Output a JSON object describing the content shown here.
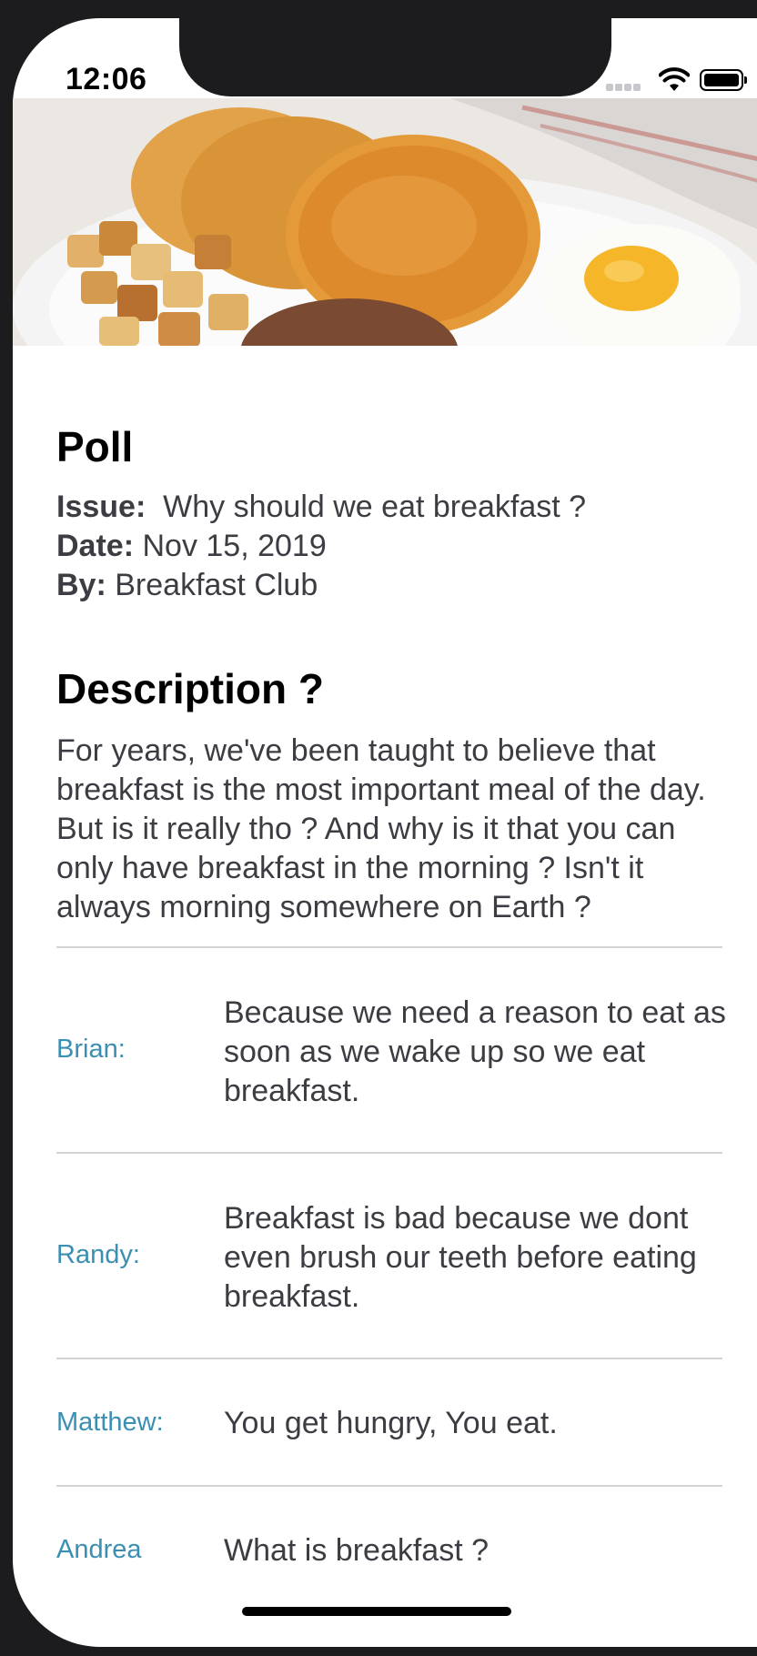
{
  "status_bar": {
    "time": "12:06"
  },
  "poll": {
    "title": "Poll",
    "issue_label": "Issue:",
    "issue": "Why should we eat breakfast ?",
    "date_label": "Date:",
    "date": "Nov 15, 2019",
    "by_label": "By:",
    "by": "Breakfast Club"
  },
  "description": {
    "title": "Description ?",
    "text": "For years, we've been taught to believe that breakfast is the most important meal of the day. But is it really tho ? And why is it that you can only have breakfast in the morning ? Isn't it always morning somewhere on Earth ?"
  },
  "answers": [
    {
      "name": "Brian:",
      "text": "Because we need a reason to eat as soon as we wake up so we eat breakfast."
    },
    {
      "name": "Randy:",
      "text": "Breakfast is bad because we dont even brush our teeth before eating breakfast."
    },
    {
      "name": "Matthew:",
      "text": "You get hungry, You eat."
    },
    {
      "name": "Andrea",
      "text": "What is breakfast ?"
    }
  ],
  "colors": {
    "accent": "#3a8fb3",
    "text": "#3c3c43"
  }
}
